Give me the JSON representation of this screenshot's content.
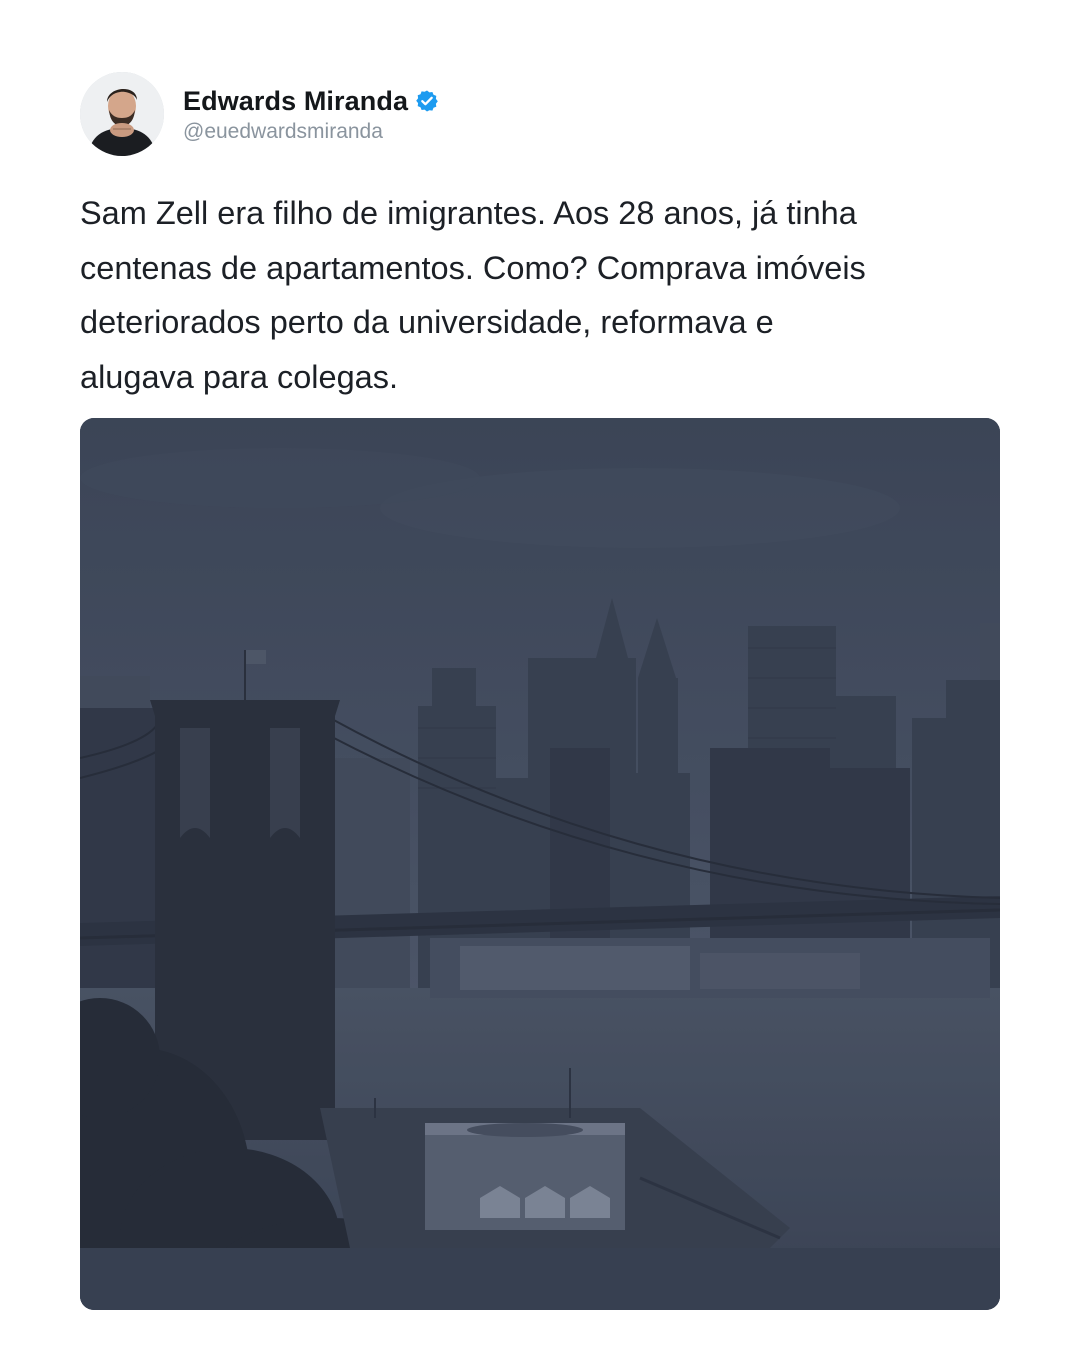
{
  "author": {
    "name": "Edwards Miranda",
    "handle": "@euedwardsmiranda",
    "verified": true,
    "avatar_icon": "profile-photo"
  },
  "tweet": {
    "text": "Sam Zell era filho de imigrantes. Aos 28 anos, já tinha\ncentenas de apartamentos. Como? Comprava imóveis\ndeteriorados perto da universidade, reformava e\nalugava para colegas."
  },
  "media": {
    "icon": "city-skyline-bridge-photo"
  },
  "colors": {
    "verified_badge": "#1d9bf0",
    "handle_text": "#8a949e",
    "photo_tint": "#3b4456"
  }
}
